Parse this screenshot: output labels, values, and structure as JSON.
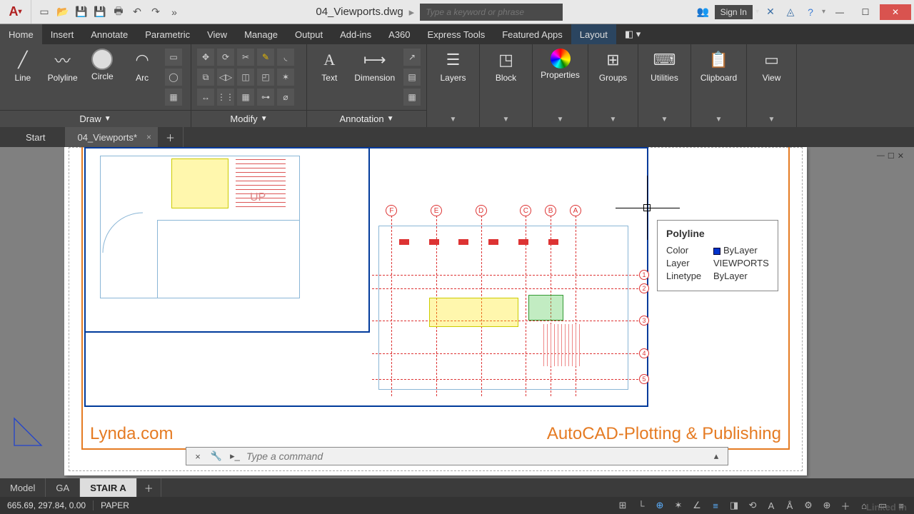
{
  "title": "04_Viewports.dwg",
  "search_placeholder": "Type a keyword or phrase",
  "signin": "Sign In",
  "ribbon_tabs": [
    "Home",
    "Insert",
    "Annotate",
    "Parametric",
    "View",
    "Manage",
    "Output",
    "Add-ins",
    "A360",
    "Express Tools",
    "Featured Apps",
    "Layout"
  ],
  "ribbon_active": "Home",
  "ribbon_highlight": "Layout",
  "panels": {
    "draw": {
      "title": "Draw",
      "tools": [
        "Line",
        "Polyline",
        "Circle",
        "Arc"
      ]
    },
    "modify": {
      "title": "Modify"
    },
    "annotation": {
      "title": "Annotation",
      "tools": [
        "Text",
        "Dimension"
      ]
    },
    "layers": "Layers",
    "block": "Block",
    "properties": "Properties",
    "groups": "Groups",
    "utilities": "Utilities",
    "clipboard": "Clipboard",
    "view": "View"
  },
  "filetabs": {
    "start": "Start",
    "active": "04_Viewports*"
  },
  "layout_tabs": [
    "Model",
    "GA",
    "STAIR A"
  ],
  "layout_active": "STAIR A",
  "sheet": {
    "brand": "Lynda.com",
    "title": "AutoCAD-Plotting & Publishing",
    "up_label": "UP"
  },
  "grid_cols": [
    "F",
    "E",
    "D",
    "C",
    "B",
    "A"
  ],
  "grid_rows": [
    "1",
    "2",
    "3",
    "4",
    "5"
  ],
  "tooltip": {
    "title": "Polyline",
    "color_label": "Color",
    "color_value": "ByLayer",
    "layer_label": "Layer",
    "layer_value": "VIEWPORTS",
    "linetype_label": "Linetype",
    "linetype_value": "ByLayer"
  },
  "command_placeholder": "Type a command",
  "status": {
    "coords": "665.69, 297.84, 0.00",
    "space": "PAPER"
  },
  "watermark": "Linked in"
}
